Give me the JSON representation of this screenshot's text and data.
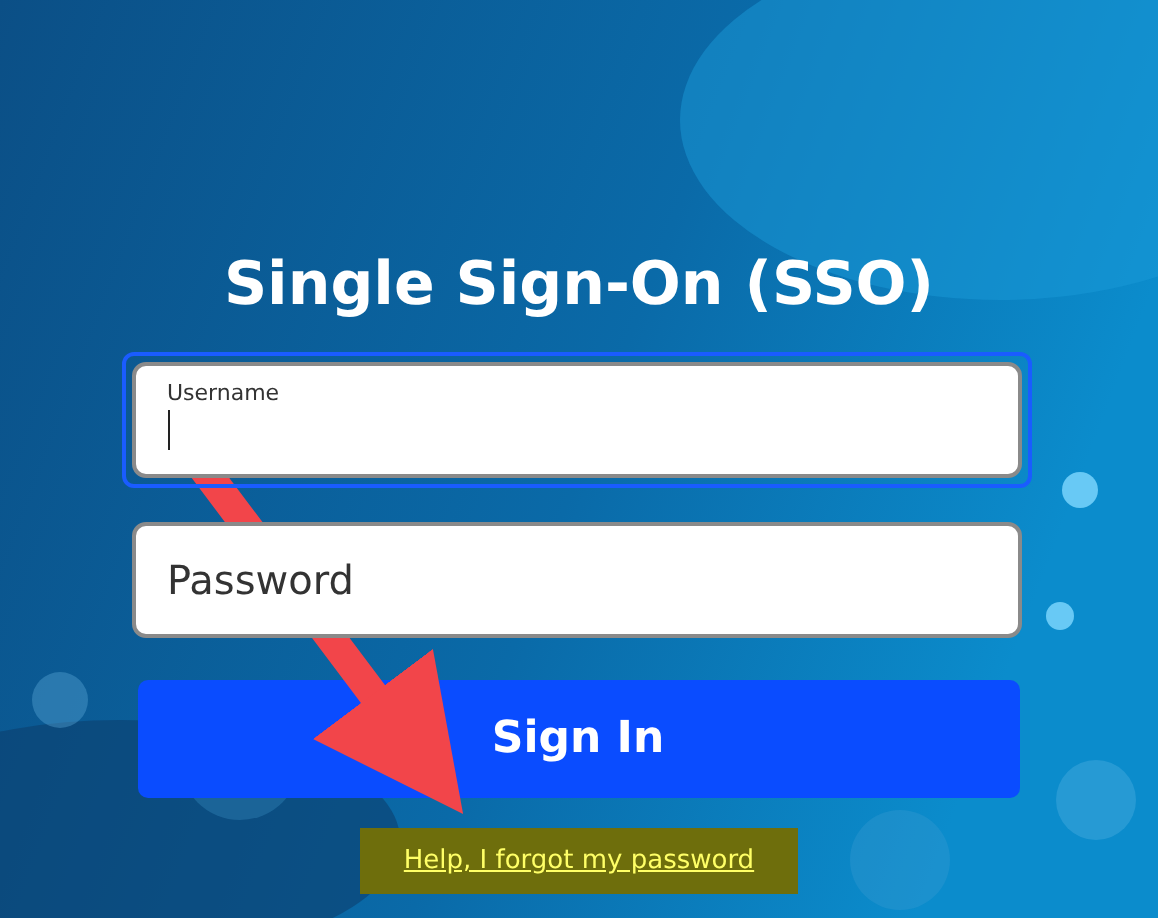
{
  "title": "Single Sign-On (SSO)",
  "username": {
    "label": "Username",
    "focused": true
  },
  "password": {
    "placeholder": "Password",
    "focused": false
  },
  "sign_in_button": "Sign In",
  "help_link": "Help, I forgot my password"
}
